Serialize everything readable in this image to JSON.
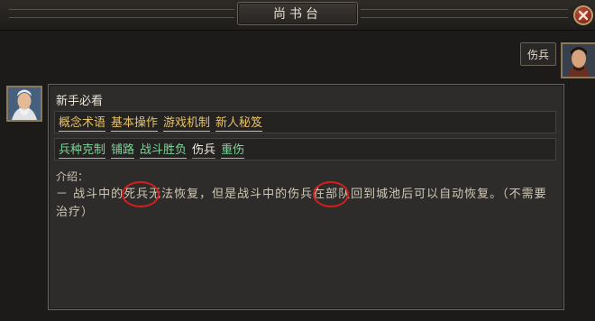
{
  "header": {
    "title": "尚书台"
  },
  "chat": {
    "user_message": "伤兵",
    "panel": {
      "title": "新手必看",
      "main_tabs": [
        "概念术语",
        "基本操作",
        "游戏机制",
        "新人秘笈"
      ],
      "sub_tabs": [
        "兵种克制",
        "铺路",
        "战斗胜负",
        "伤兵",
        "重伤"
      ],
      "active_sub_tab": "伤兵",
      "intro_label": "介绍：",
      "intro_text": "－ 战斗中的死兵无法恢复，但是战斗中的伤兵在部队回到城池后可以自动恢复。（不需要治疗）"
    }
  },
  "colors": {
    "main_tab": "#e6c062",
    "sub_tab": "#7dd39a",
    "active_tab": "#f1ece0",
    "annotation_circle": "#d41e1e"
  },
  "icons": {
    "close": "close-icon",
    "npc_avatar": "advisor-avatar",
    "player_avatar": "player-avatar"
  }
}
